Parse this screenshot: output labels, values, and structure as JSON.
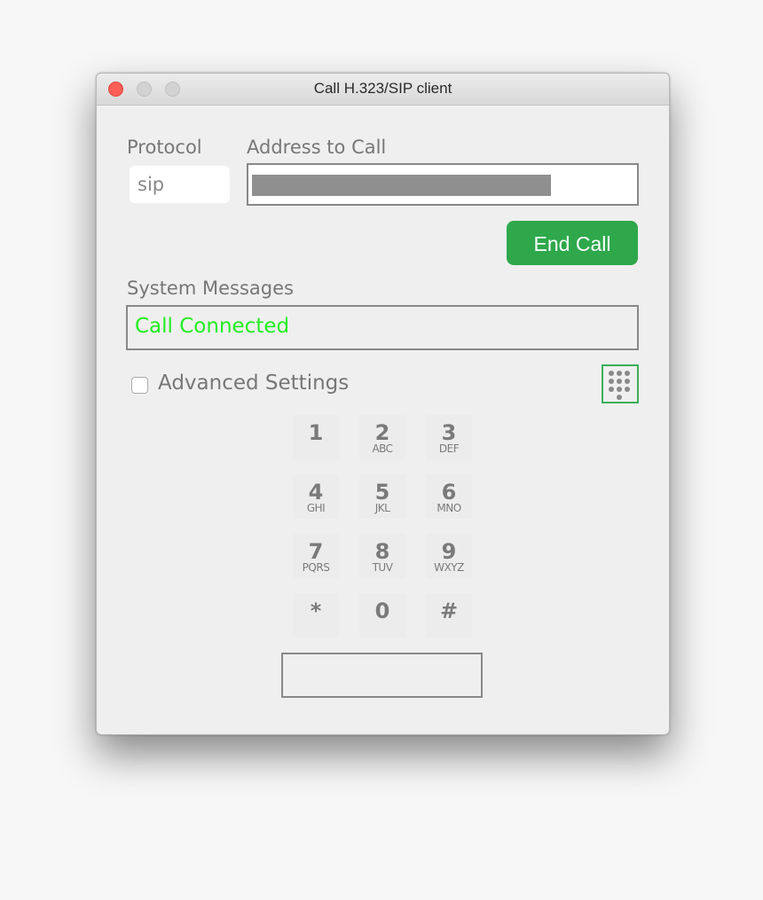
{
  "window": {
    "title": "Call H.323/SIP client",
    "controls": [
      "close",
      "minimize",
      "maximize"
    ]
  },
  "form": {
    "protocol_label": "Protocol",
    "protocol_value": "sip",
    "address_label": "Address to Call",
    "address_value": "[redacted]",
    "end_call_label": "End Call",
    "end_call_color": "#2ea84b"
  },
  "messages": {
    "label": "System Messages",
    "text": "Call Connected",
    "text_color": "#22ee22"
  },
  "advanced": {
    "label": "Advanced Settings",
    "checked": false
  },
  "dialpad": {
    "toggle_icon": "dialpad-icon",
    "keys": [
      {
        "digit": "1",
        "letters": ""
      },
      {
        "digit": "2",
        "letters": "ABC"
      },
      {
        "digit": "3",
        "letters": "DEF"
      },
      {
        "digit": "4",
        "letters": "GHI"
      },
      {
        "digit": "5",
        "letters": "JKL"
      },
      {
        "digit": "6",
        "letters": "MNO"
      },
      {
        "digit": "7",
        "letters": "PQRS"
      },
      {
        "digit": "8",
        "letters": "TUV"
      },
      {
        "digit": "9",
        "letters": "WXYZ"
      },
      {
        "digit": "*",
        "letters": ""
      },
      {
        "digit": "0",
        "letters": ""
      },
      {
        "digit": "#",
        "letters": ""
      }
    ],
    "display_value": ""
  }
}
